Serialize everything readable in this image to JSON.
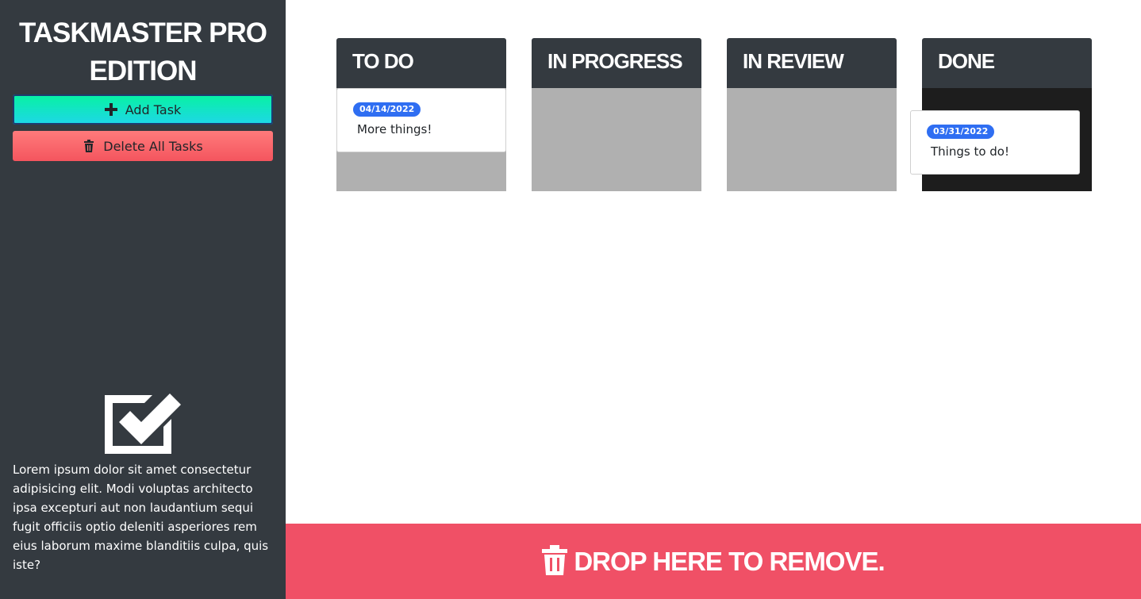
{
  "sidebar": {
    "title_line1": "TASKMASTER PRO",
    "title_line2": "EDITION",
    "add_button_label": "Add Task",
    "delete_button_label": "Delete All Tasks",
    "description": "Lorem ipsum dolor sit amet consectetur adipisicing elit. Modi voluptas architecto ipsa excepturi aut non laudantium sequi fugit officiis optio deleniti asperiores rem eius laborum maxime blanditiis culpa, quis iste?",
    "logo_icon": "check-square-icon"
  },
  "columns": [
    {
      "title": "TO DO",
      "cards": [
        {
          "date": "04/14/2022",
          "text": "More things!"
        }
      ]
    },
    {
      "title": "IN PROGRESS",
      "cards": []
    },
    {
      "title": "IN REVIEW",
      "cards": []
    },
    {
      "title": "DONE",
      "cards": [
        {
          "date": "03/31/2022",
          "text": "Things to do!"
        }
      ]
    }
  ],
  "drop_zone": {
    "label": "DROP HERE TO REMOVE.",
    "icon": "trash-icon"
  },
  "colors": {
    "sidebar_bg": "#343a40",
    "column_header": "#343a40",
    "column_body": "#b0b0b0",
    "done_body": "#1d1d1d",
    "badge": "#2f6ef2",
    "drop_zone": "#f05066",
    "add_button": "#07f3a1",
    "delete_button": "#f4555e"
  }
}
